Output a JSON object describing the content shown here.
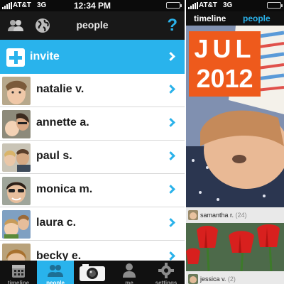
{
  "left_phone": {
    "status": {
      "carrier": "AT&T",
      "network": "3G",
      "time": "12:34 PM",
      "battery_level": 0.85
    },
    "nav": {
      "title": "people",
      "people_icon": "people-icon",
      "globe_icon": "globe-icon",
      "help_label": "?"
    },
    "invite": {
      "label": "invite"
    },
    "people": [
      {
        "name": "natalie v."
      },
      {
        "name": "annette a."
      },
      {
        "name": "paul s."
      },
      {
        "name": "monica m."
      },
      {
        "name": "laura c."
      },
      {
        "name": "becky e."
      }
    ],
    "tabs": [
      {
        "label": "timeline",
        "icon": "calendar-icon",
        "active": false
      },
      {
        "label": "people",
        "icon": "people-icon",
        "active": true
      },
      {
        "label": "",
        "icon": "camera-icon",
        "active": false
      },
      {
        "label": "me",
        "icon": "person-icon",
        "active": false
      },
      {
        "label": "settings",
        "icon": "gear-icon",
        "active": false
      }
    ]
  },
  "right_phone": {
    "status": {
      "carrier": "AT&T",
      "network": "3G",
      "battery_level": 0.85
    },
    "nav": {
      "tab_timeline": "timeline",
      "tab_people": "people"
    },
    "date": {
      "month": "JUL",
      "year": "2012"
    },
    "posts": [
      {
        "author": "samantha r.",
        "count": "(24)"
      },
      {
        "author": "jessica v.",
        "count": "(2)"
      }
    ]
  },
  "colors": {
    "accent": "#29b3ec",
    "date_orange": "#ee5a1c",
    "bar_dark": "#181818"
  }
}
